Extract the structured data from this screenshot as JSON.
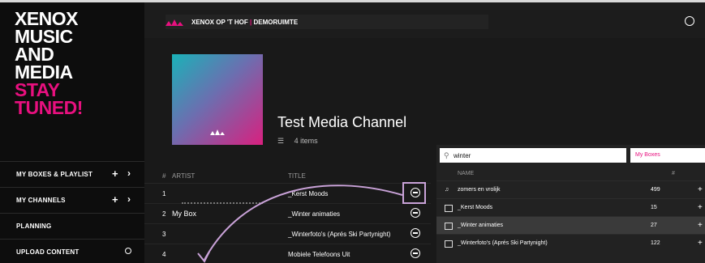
{
  "sidebar": {
    "brand_lines": [
      "XENOX",
      "MUSIC",
      "AND",
      "MEDIA",
      "STAY",
      "TUNED!"
    ],
    "items": [
      {
        "label": "MY BOXES & PLAYLIST",
        "plus": "+",
        "chevron": "›"
      },
      {
        "label": "MY CHANNELS",
        "plus": "+",
        "chevron": "›"
      },
      {
        "label": "PLANNING"
      },
      {
        "label": "UPLOAD CONTENT"
      }
    ]
  },
  "header": {
    "location": "XENOX OP 'T HOF",
    "separator": "|",
    "room": "DEMORUIMTE"
  },
  "channel": {
    "title": "Test Media Channel",
    "count": "4 items"
  },
  "table": {
    "headers": {
      "num": "#",
      "artist": "ARTIST",
      "title": "TITLE"
    },
    "rows": [
      {
        "num": "1",
        "artist": "",
        "title": "_Kerst Moods"
      },
      {
        "num": "2",
        "artist": "My Box",
        "title": "_Winter animaties"
      },
      {
        "num": "3",
        "artist": "",
        "title": "_Winterfoto's (Aprés Ski Partynight)"
      },
      {
        "num": "4",
        "artist": "",
        "title": "Mobiele Telefoons Uit"
      }
    ]
  },
  "picker": {
    "search_value": "winter",
    "select_value": "My Boxes",
    "headers": {
      "name": "NAME",
      "count": "#"
    },
    "rows": [
      {
        "name": "zomers en vrolijk",
        "count": "499"
      },
      {
        "name": "_Kerst Moods",
        "count": "15"
      },
      {
        "name": "_Winter animaties",
        "count": "27"
      },
      {
        "name": "_Winterfoto's (Aprés Ski Partynight)",
        "count": "122"
      }
    ]
  },
  "colors": {
    "accent": "#e8107f",
    "background": "#161616"
  }
}
